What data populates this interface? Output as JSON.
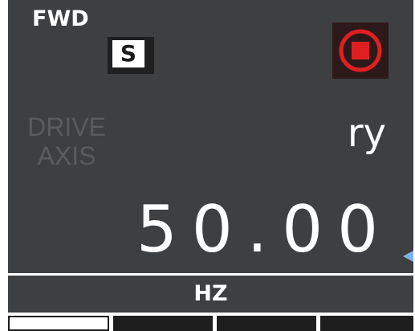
{
  "header": {
    "direction": "FWD",
    "source_badge": "S",
    "run_status_icon": "stop-icon"
  },
  "display": {
    "parameter_name": "DRIVE AXIS",
    "status_code": "ry",
    "value": "50.00",
    "unit": "HZ"
  },
  "softkeys": {
    "selected_index": 0,
    "count": 4
  },
  "colors": {
    "panel": "#3e3f41",
    "text": "#ffffff",
    "dim_text": "#5a5b5d",
    "stop_red": "#e02020",
    "marker_blue": "#7fb3e6"
  }
}
